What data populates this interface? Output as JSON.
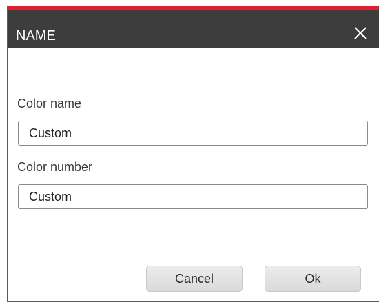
{
  "dialog": {
    "title": "NAME",
    "close_icon": "close-icon",
    "colors": {
      "titlebar_bg": "#3d3d3d",
      "accent": "#e0202e",
      "title_text": "#ffffff"
    }
  },
  "form": {
    "color_name": {
      "label": "Color name",
      "value": "Custom"
    },
    "color_number": {
      "label": "Color number",
      "value": "Custom"
    }
  },
  "buttons": {
    "cancel_label": "Cancel",
    "ok_label": "Ok"
  }
}
